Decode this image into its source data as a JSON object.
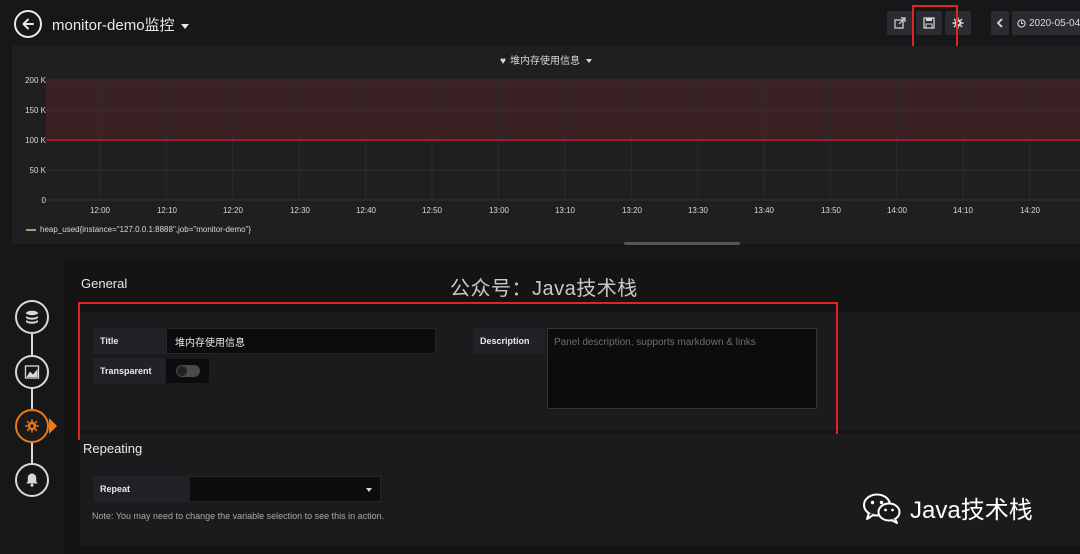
{
  "header": {
    "title": "monitor-demo监控",
    "time_range": "2020-05-04"
  },
  "panel": {
    "title": "堆内存使用信息",
    "y_ticks": [
      "200 K",
      "150 K",
      "100 K",
      "50 K",
      "0"
    ],
    "x_ticks": [
      "12:00",
      "12:10",
      "12:20",
      "12:30",
      "12:40",
      "12:50",
      "13:00",
      "13:10",
      "13:20",
      "13:30",
      "13:40",
      "13:50",
      "14:00",
      "14:10",
      "14:20"
    ],
    "legend": "heap_used{instance=\"127.0.0.1:8888\",job=\"monitor-demo\"}"
  },
  "chart_data": {
    "type": "line",
    "title": "堆内存使用信息",
    "xlabel": "",
    "ylabel": "",
    "x": [
      "12:00",
      "12:10",
      "12:20",
      "12:30",
      "12:40",
      "12:50",
      "13:00",
      "13:10",
      "13:20",
      "13:30",
      "13:40",
      "13:50",
      "14:00",
      "14:10",
      "14:20"
    ],
    "series": [
      {
        "name": "heap_used{instance=\"127.0.0.1:8888\",job=\"monitor-demo\"}",
        "values": []
      }
    ],
    "threshold": 100000,
    "ylim": [
      0,
      200000
    ],
    "legend_position": "bottom-left",
    "grid": true
  },
  "general": {
    "section_title": "General",
    "title_label": "Title",
    "title_value": "堆内存使用信息",
    "transparent_label": "Transparent",
    "description_label": "Description",
    "description_placeholder": "Panel description, supports markdown & links"
  },
  "repeating": {
    "section_title": "Repeating",
    "repeat_label": "Repeat",
    "note": "Note: You may need to change the variable selection to see this in action."
  },
  "watermarks": {
    "top": "公众号：Java技术栈",
    "bottom": "Java技术栈"
  },
  "colors": {
    "threshold_line": "#c4162a",
    "threshold_fill": "#3a2224",
    "active_nav": "#eb7b18",
    "highlight_box": "#e02424"
  }
}
